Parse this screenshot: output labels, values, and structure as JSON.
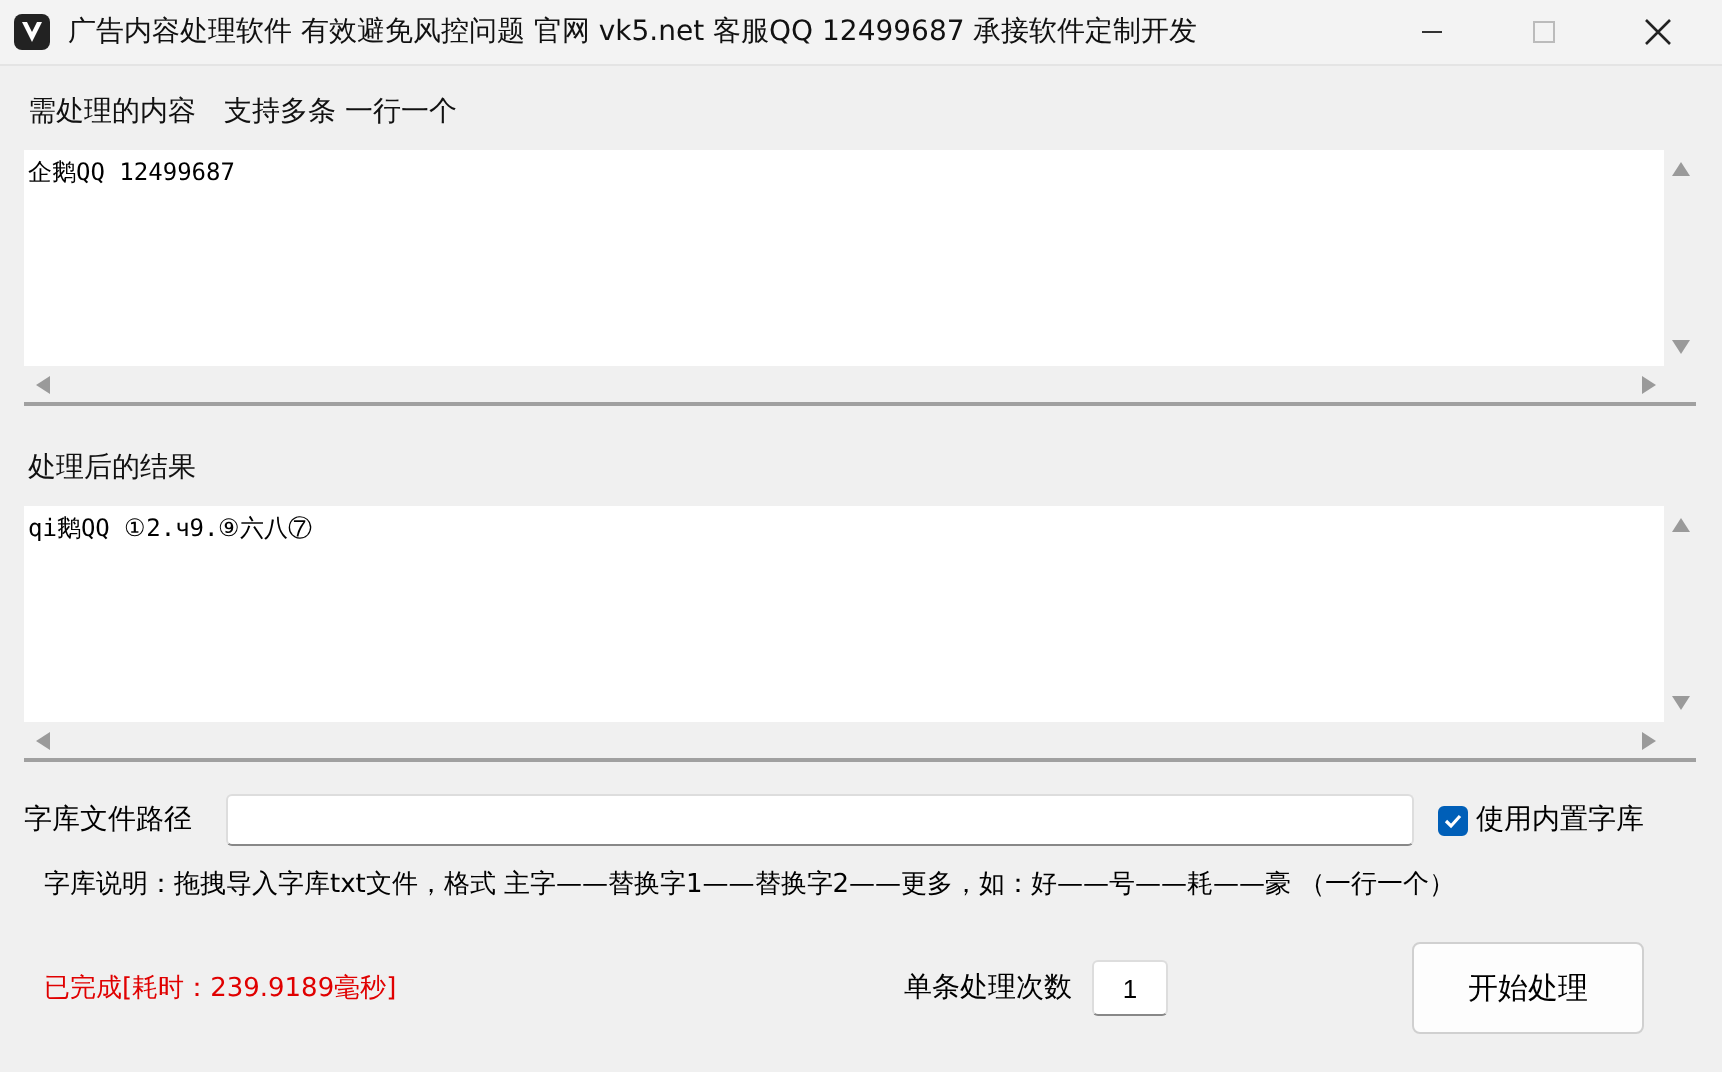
{
  "window": {
    "title": "广告内容处理软件 有效避免风控问题 官网 vk5.net 客服QQ 12499687 承接软件定制开发"
  },
  "input_section": {
    "label": "需处理的内容　支持多条 一行一个",
    "value": "企鹅QQ 12499687"
  },
  "output_section": {
    "label": "处理后的结果",
    "value": "qi鹅QQ ①2.ч9.⑨六八⑦"
  },
  "library": {
    "label": "字库文件路径",
    "builtin_checkbox": {
      "label": "使用内置字库",
      "checked": true
    },
    "description": "字库说明：拖拽导入字库txt文件，格式 主字——替换字1——替换字2——更多，如：好——号——耗——豪 （一行一个）"
  },
  "footer": {
    "status": "已完成[耗时：239.9189毫秒]",
    "count_label": "单条处理次数",
    "count_value": "1",
    "start_button": "开始处理"
  }
}
